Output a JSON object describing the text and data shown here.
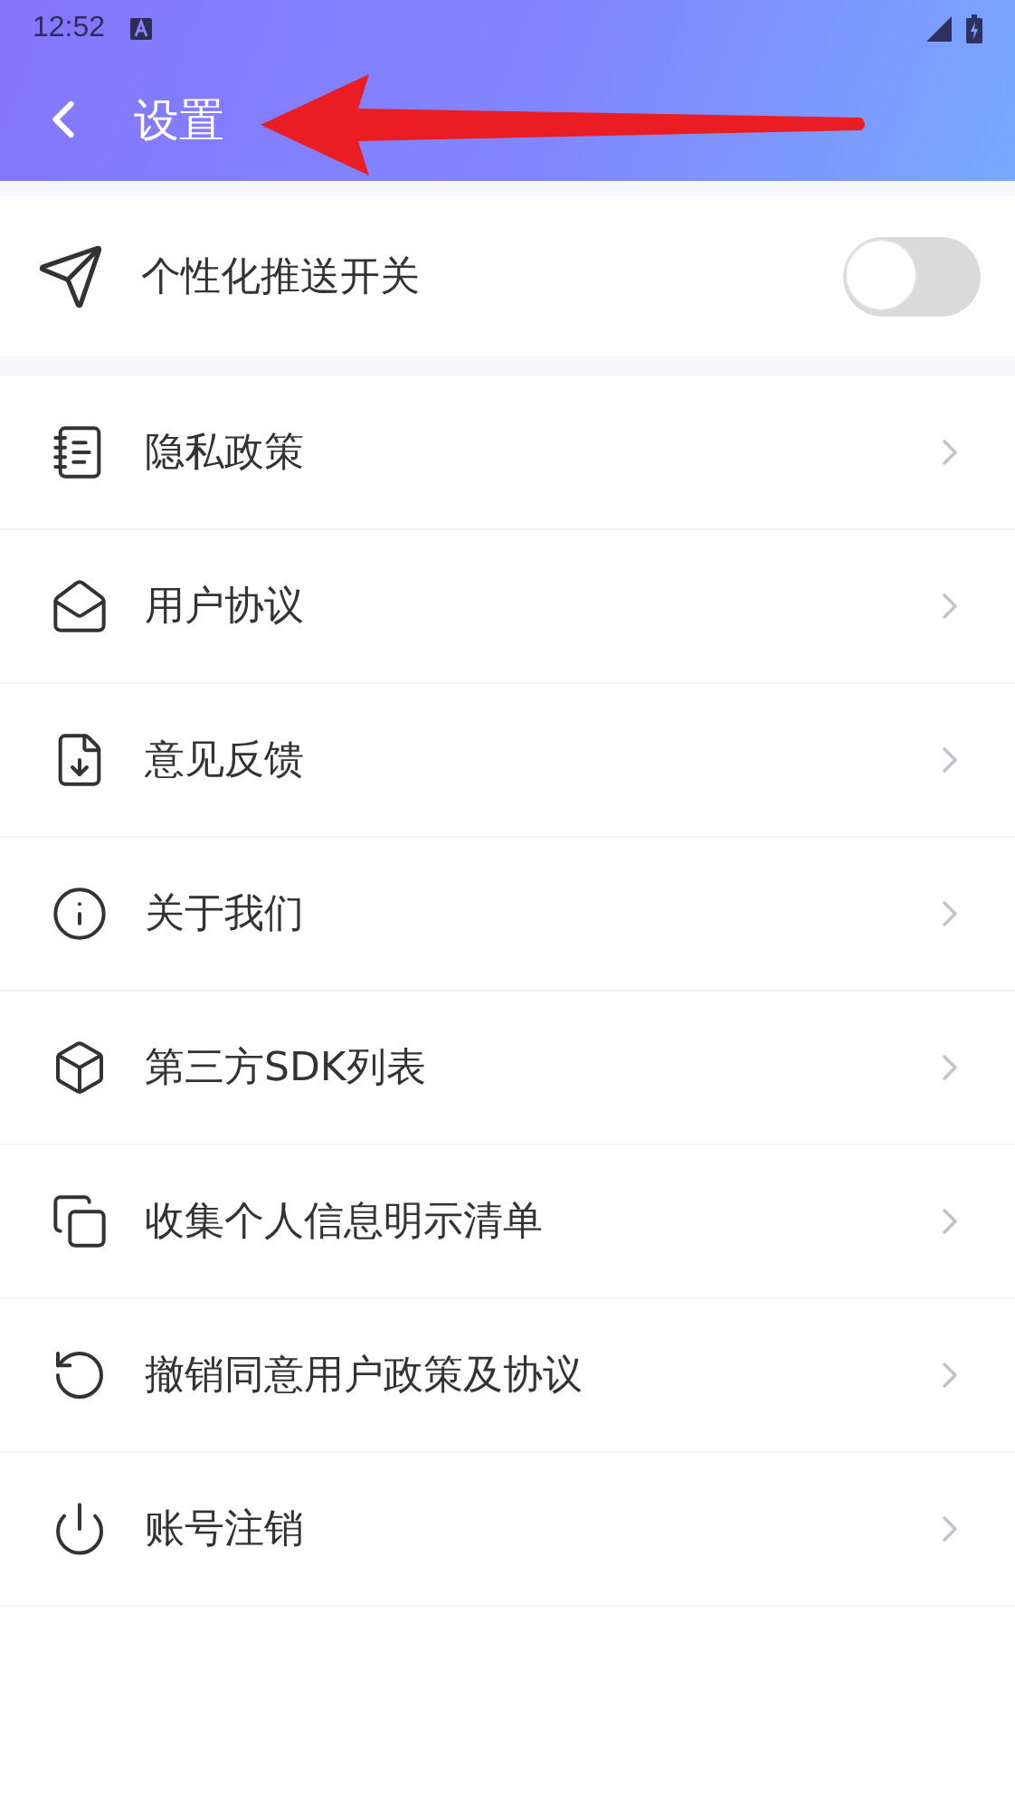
{
  "status_bar": {
    "time": "12:52"
  },
  "header": {
    "title": "设置"
  },
  "push_toggle": {
    "label": "个性化推送开关",
    "on": false
  },
  "menu": {
    "items": [
      {
        "label": "隐私政策"
      },
      {
        "label": "用户协议"
      },
      {
        "label": "意见反馈"
      },
      {
        "label": "关于我们"
      },
      {
        "label": "第三方SDK列表"
      },
      {
        "label": "收集个人信息明示清单"
      },
      {
        "label": "撤销同意用户政策及协议"
      },
      {
        "label": "账号注销"
      }
    ]
  }
}
